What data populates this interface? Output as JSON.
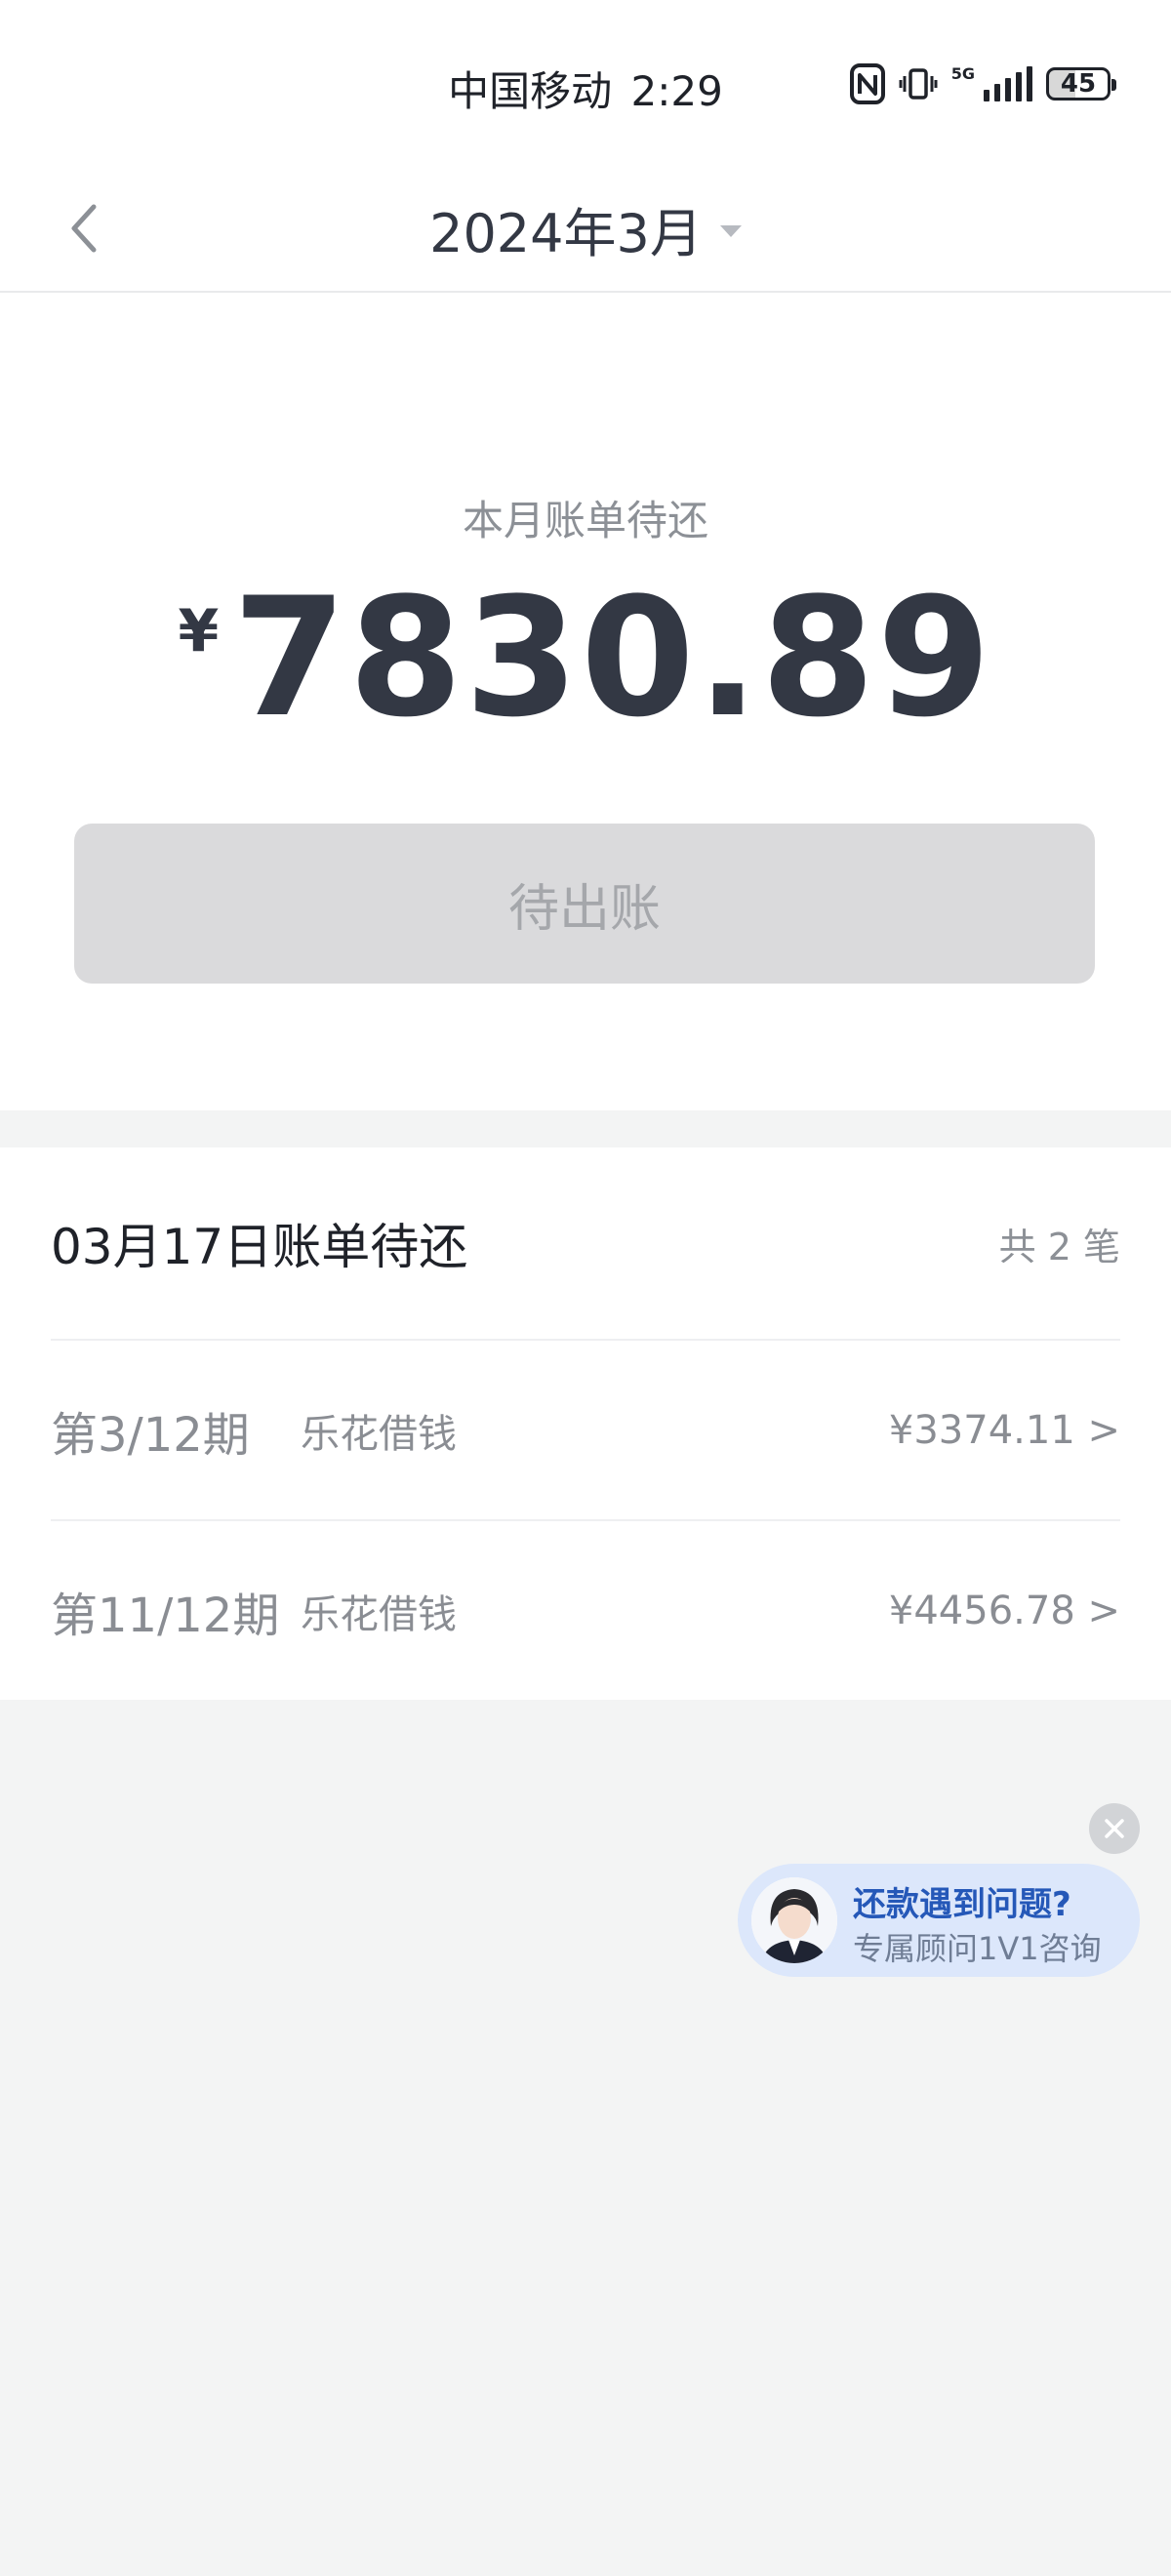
{
  "status_bar": {
    "carrier": "中国移动",
    "time": "2:29",
    "network": "5G",
    "battery": "45"
  },
  "nav": {
    "title": "2024年3月"
  },
  "summary": {
    "label": "本月账单待还",
    "currency": "¥",
    "amount": "7830.89",
    "button_label": "待出账"
  },
  "bill_list": {
    "header_title": "03月17日账单待还",
    "count_text": "共 2 笔",
    "items": [
      {
        "period": "第3/12期",
        "product": "乐花借钱",
        "amount": "¥3374.11 >"
      },
      {
        "period": "第11/12期",
        "product": "乐花借钱",
        "amount": "¥4456.78 >"
      }
    ]
  },
  "consult": {
    "line1": "还款遇到问题?",
    "line2": "专属顾问1V1咨询"
  }
}
